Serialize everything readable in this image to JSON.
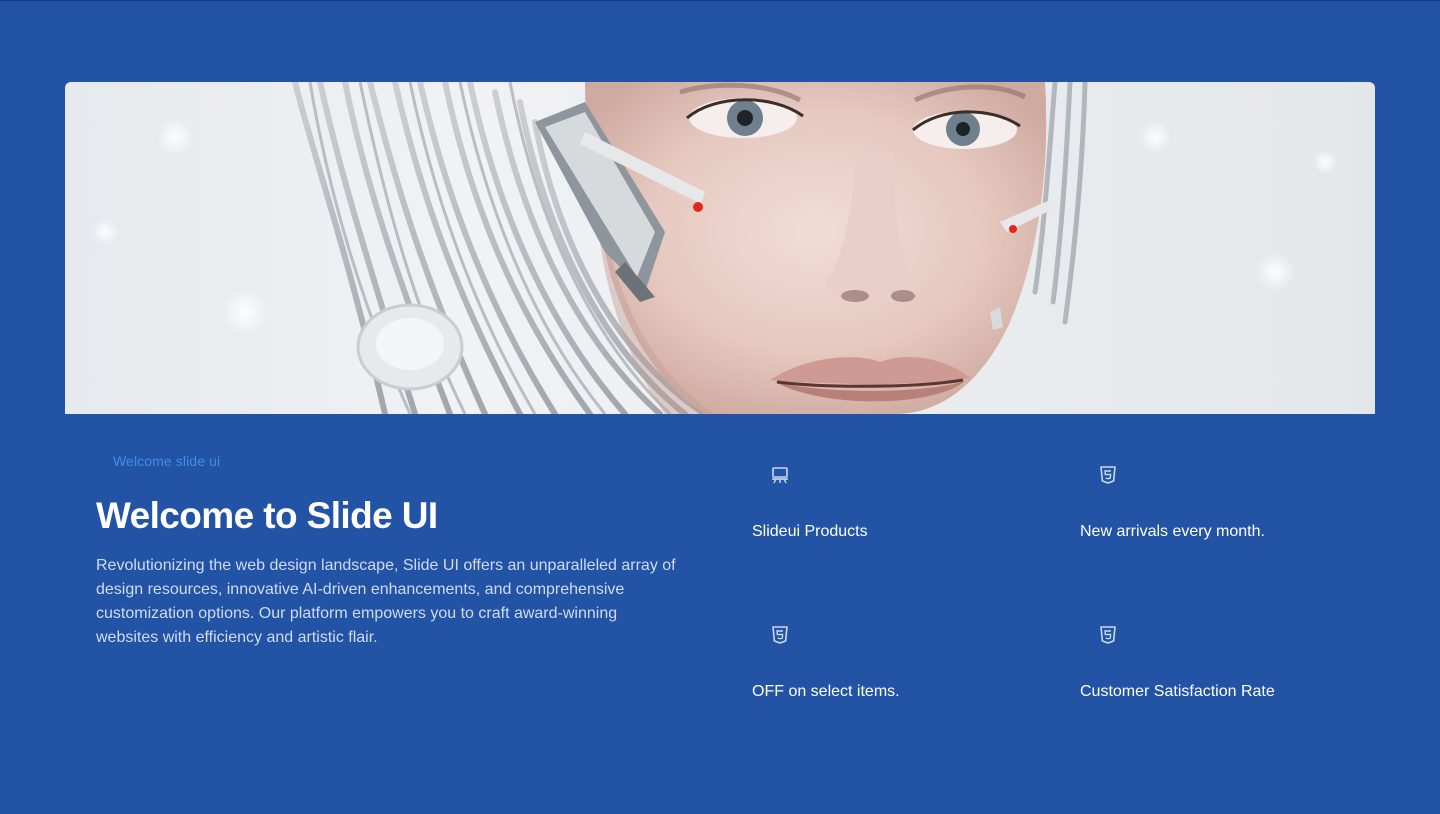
{
  "hero": {
    "image_subject": "android-face-photo"
  },
  "intro": {
    "eyebrow": "Welcome slide ui",
    "headline": "Welcome to Slide UI",
    "description": "Revolutionizing the web design landscape, Slide UI offers an unparalleled array of design resources, innovative AI-driven enhancements, and comprehensive customization options. Our platform empowers you to craft award-winning websites with efficiency and artistic flair."
  },
  "features": [
    {
      "icon": "presentation-board-icon",
      "label": "Slideui Products"
    },
    {
      "icon": "html5-shield-icon",
      "label": "New arrivals every month."
    },
    {
      "icon": "html5-shield-icon",
      "label": "OFF on select items."
    },
    {
      "icon": "html5-shield-icon",
      "label": "Customer Satisfaction Rate"
    }
  ],
  "colors": {
    "background": "#2253a5",
    "eyebrow": "#3d8fe8",
    "headline": "#ffffff",
    "body_text": "#cfdcf3",
    "icon": "#c9d8f2"
  }
}
